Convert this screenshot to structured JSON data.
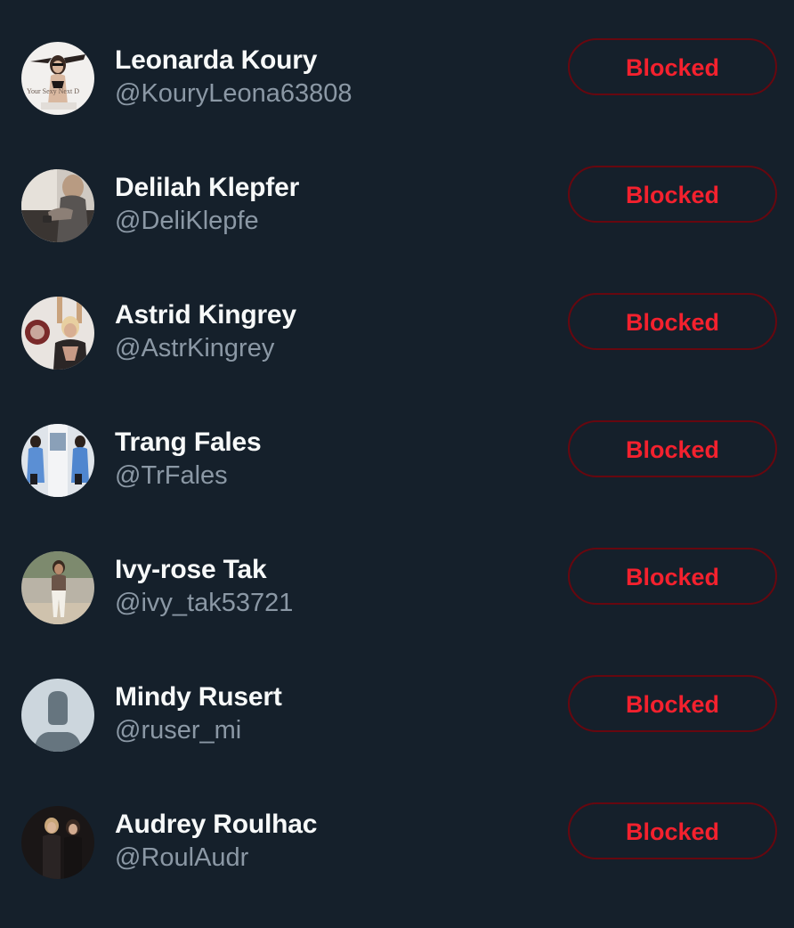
{
  "blocked_list": {
    "button_label": "Blocked",
    "accent_color": "#f4212e",
    "users": [
      {
        "name": "Leonarda Koury",
        "handle": "@KouryLeona63808",
        "avatar": "photo",
        "avatar_text": "Your Sexy Next D"
      },
      {
        "name": "Delilah Klepfer",
        "handle": "@DeliKlepfe",
        "avatar": "photo"
      },
      {
        "name": "Astrid Kingrey",
        "handle": "@AstrKingrey",
        "avatar": "photo"
      },
      {
        "name": "Trang Fales",
        "handle": "@TrFales",
        "avatar": "photo"
      },
      {
        "name": "Ivy-rose Tak",
        "handle": "@ivy_tak53721",
        "avatar": "photo"
      },
      {
        "name": "Mindy Rusert",
        "handle": "@ruser_mi",
        "avatar": "default-profile-icon"
      },
      {
        "name": "Audrey Roulhac",
        "handle": "@RoulAudr",
        "avatar": "photo"
      }
    ]
  }
}
